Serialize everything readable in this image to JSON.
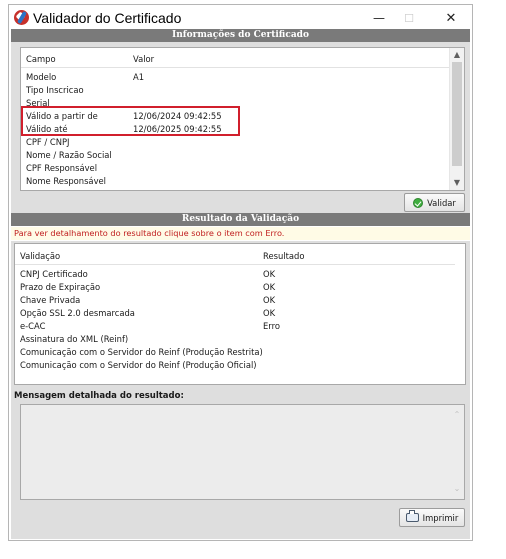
{
  "window": {
    "title": "Validador do Certificado",
    "minimize": "—",
    "maximize": "☐",
    "close": "✕"
  },
  "cert_section": {
    "header": "Informações do Certificado",
    "columns": {
      "campo": "Campo",
      "valor": "Valor"
    },
    "rows": [
      {
        "campo": "Modelo",
        "valor": "A1"
      },
      {
        "campo": "Tipo Inscricao",
        "valor": ""
      },
      {
        "campo": "Serial",
        "valor": ""
      },
      {
        "campo": "Válido a partir de",
        "valor": "12/06/2024 09:42:55"
      },
      {
        "campo": "Válido até",
        "valor": "12/06/2025 09:42:55"
      },
      {
        "campo": "CPF / CNPJ",
        "valor": ""
      },
      {
        "campo": "Nome / Razão Social",
        "valor": ""
      },
      {
        "campo": "CPF Responsável",
        "valor": ""
      },
      {
        "campo": "Nome Responsável",
        "valor": ""
      }
    ],
    "validate_button": "Validar"
  },
  "result_section": {
    "header": "Resultado da Validação",
    "hint": "Para ver detalhamento do resultado clique sobre o item com Erro.",
    "columns": {
      "validacao": "Validação",
      "resultado": "Resultado"
    },
    "rows": [
      {
        "validacao": "CNPJ Certificado",
        "resultado": "OK"
      },
      {
        "validacao": "Prazo de Expiração",
        "resultado": "OK"
      },
      {
        "validacao": "Chave Privada",
        "resultado": "OK"
      },
      {
        "validacao": "Opção SSL 2.0 desmarcada",
        "resultado": "OK"
      },
      {
        "validacao": "e-CAC",
        "resultado": "Erro"
      },
      {
        "validacao": "Assinatura do XML (Reinf)",
        "resultado": ""
      },
      {
        "validacao": "Comunicação com o Servidor do Reinf (Produção Restrita)",
        "resultado": ""
      },
      {
        "validacao": "Comunicação com o Servidor do Reinf (Produção Oficial)",
        "resultado": ""
      }
    ]
  },
  "message_section": {
    "label": "Mensagem detalhada do resultado:",
    "text": ""
  },
  "print_button": "Imprimir",
  "icons": {
    "app": "certificate-app-icon",
    "validate": "check-circle-icon",
    "print": "printer-icon"
  },
  "colors": {
    "header_bg": "#7a7a7a",
    "panel_bg": "#dedede",
    "highlight": "#d11f2c",
    "hint_text": "#c02020"
  }
}
